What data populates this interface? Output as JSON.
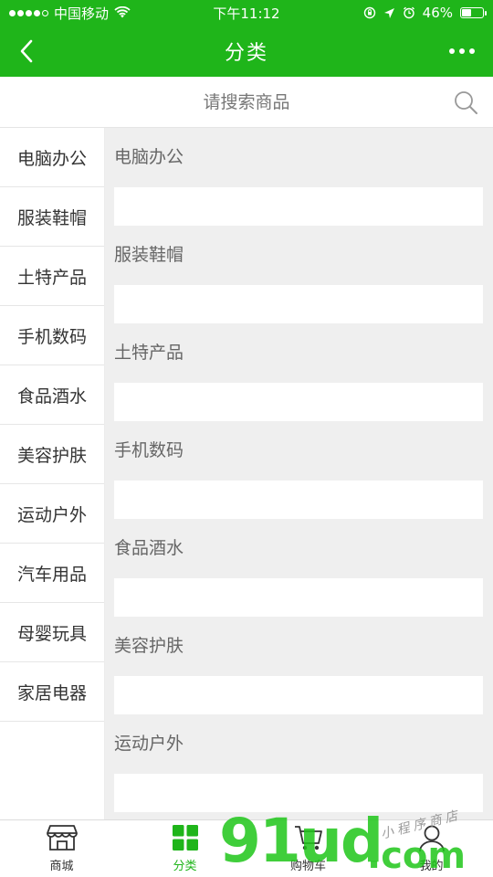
{
  "status_bar": {
    "carrier": "中国移动",
    "time": "下午11:12",
    "battery": "46%",
    "battery_level": 0.46,
    "signal_bars": 4,
    "signal_total": 5
  },
  "nav": {
    "title": "分类",
    "back_icon": "chevron-left-icon",
    "more_icon": "more-dots-icon"
  },
  "search": {
    "placeholder": "请搜索商品",
    "icon": "search-icon"
  },
  "sidebar": {
    "items": [
      {
        "label": "电脑办公"
      },
      {
        "label": "服装鞋帽"
      },
      {
        "label": "土特产品"
      },
      {
        "label": "手机数码"
      },
      {
        "label": "食品酒水"
      },
      {
        "label": "美容护肤"
      },
      {
        "label": "运动户外"
      },
      {
        "label": "汽车用品"
      },
      {
        "label": "母婴玩具"
      },
      {
        "label": "家居电器"
      }
    ]
  },
  "content": {
    "sections": [
      {
        "title": "电脑办公"
      },
      {
        "title": "服装鞋帽"
      },
      {
        "title": "土特产品"
      },
      {
        "title": "手机数码"
      },
      {
        "title": "食品酒水"
      },
      {
        "title": "美容护肤"
      },
      {
        "title": "运动户外"
      }
    ]
  },
  "tab_bar": {
    "tabs": [
      {
        "label": "商城",
        "icon": "store-icon",
        "active": false
      },
      {
        "label": "分类",
        "icon": "grid-icon",
        "active": true
      },
      {
        "label": "购物车",
        "icon": "cart-icon",
        "active": false
      },
      {
        "label": "我的",
        "icon": "user-icon",
        "active": false
      }
    ]
  },
  "watermark": {
    "main": "91ud",
    "domain": ".com",
    "tagline": "小程序商店"
  },
  "colors": {
    "brand_green": "#1fb51a",
    "content_bg": "#efefef"
  }
}
